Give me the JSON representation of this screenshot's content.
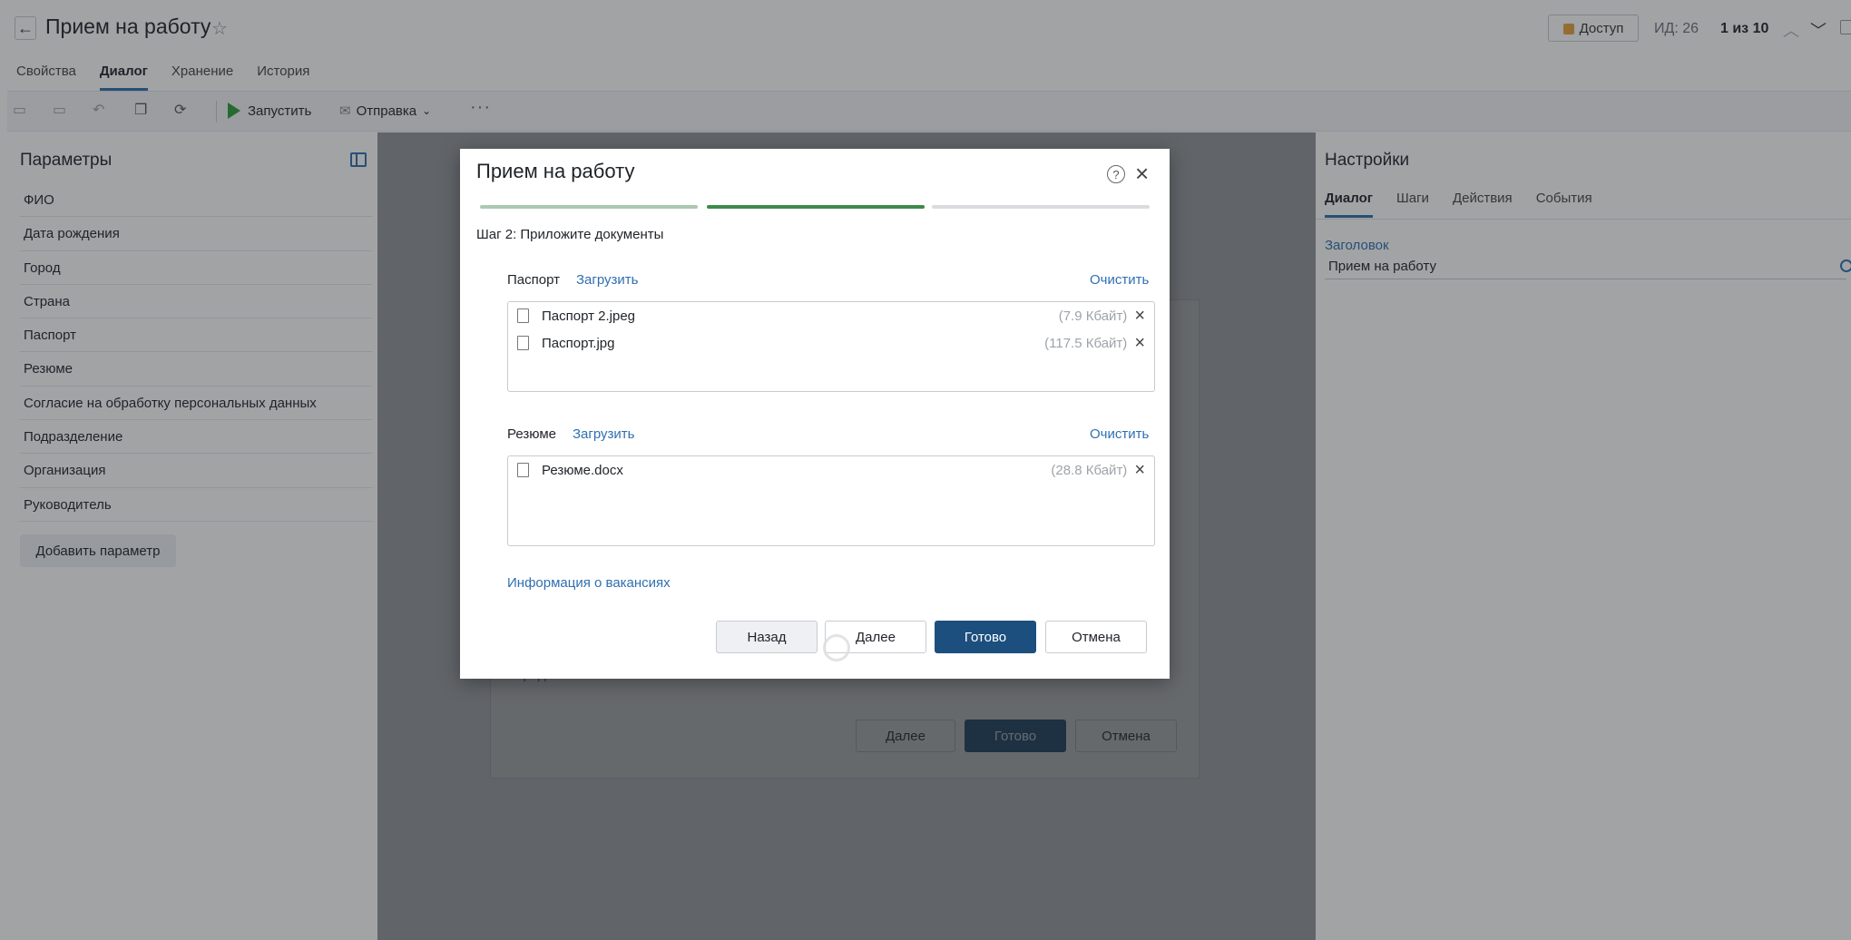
{
  "header": {
    "title": "Прием на работу",
    "access_label": "Доступ",
    "id_label": "ИД: 26",
    "record_count": "1 из 10"
  },
  "tabs": [
    {
      "label": "Свойства",
      "active": false
    },
    {
      "label": "Диалог",
      "active": true
    },
    {
      "label": "Хранение",
      "active": false
    },
    {
      "label": "История",
      "active": false
    }
  ],
  "toolbar": {
    "run_label": "Запустить",
    "send_label": "Отправка"
  },
  "left_panel": {
    "title": "Параметры",
    "items": [
      "ФИО",
      "Дата рождения",
      "Город",
      "Страна",
      "Паспорт",
      "Резюме",
      "Согласие на обработку персональных данных",
      "Подразделение",
      "Организация",
      "Руководитель"
    ],
    "add_button": "Добавить параметр"
  },
  "background_dialog": {
    "city_label": "Город",
    "next_label": "Далее",
    "done_label": "Готово",
    "cancel_label": "Отмена"
  },
  "right_panel": {
    "title": "Настройки",
    "tabs": [
      {
        "label": "Диалог",
        "active": true
      },
      {
        "label": "Шаги",
        "active": false
      },
      {
        "label": "Действия",
        "active": false
      },
      {
        "label": "События",
        "active": false
      }
    ],
    "field_label": "Заголовок",
    "field_value": "Прием на работу"
  },
  "modal": {
    "title": "Прием на работу",
    "step_text": "Шаг 2: Приложите документы",
    "steps_total": 3,
    "current_step": 2,
    "colors": {
      "done": "#a9c9b0",
      "current": "#3d8a4a",
      "todo": "#d9dbde",
      "primary": "#1c4f7e",
      "link": "#2f6fb0"
    },
    "sections": [
      {
        "label": "Паспорт",
        "upload_label": "Загрузить",
        "clear_label": "Очистить",
        "files": [
          {
            "name": "Паспорт 2.jpeg",
            "size": "(7.9 Кбайт)"
          },
          {
            "name": "Паспорт.jpg",
            "size": "(117.5 Кбайт)"
          }
        ]
      },
      {
        "label": "Резюме",
        "upload_label": "Загрузить",
        "clear_label": "Очистить",
        "files": [
          {
            "name": "Резюме.docx",
            "size": "(28.8 Кбайт)"
          }
        ]
      }
    ],
    "vacancies_link": "Информация о вакансиях",
    "buttons": {
      "back": "Назад",
      "next": "Далее",
      "done": "Готово",
      "cancel": "Отмена"
    }
  }
}
